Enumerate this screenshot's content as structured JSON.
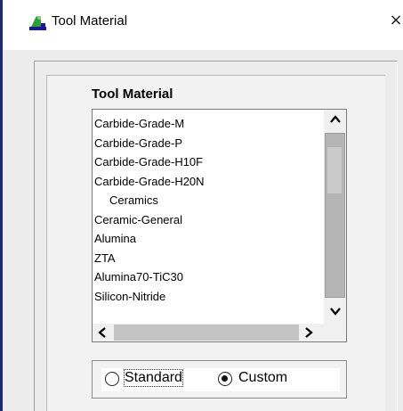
{
  "window": {
    "title": "Tool Material",
    "close_glyph": "×",
    "icon": "tool-material-app-icon"
  },
  "material_list": {
    "label": "Tool Material",
    "items": [
      {
        "label": "Carbide-Grade-M",
        "indented": false
      },
      {
        "label": "Carbide-Grade-P",
        "indented": false
      },
      {
        "label": "Carbide-Grade-H10F",
        "indented": false
      },
      {
        "label": "Carbide-Grade-H20N",
        "indented": false
      },
      {
        "label": "Ceramics",
        "indented": true
      },
      {
        "label": "Ceramic-General",
        "indented": false
      },
      {
        "label": "Alumina",
        "indented": false
      },
      {
        "label": "ZTA",
        "indented": false
      },
      {
        "label": "Alumina70-TiC30",
        "indented": false
      },
      {
        "label": "Silicon-Nitride",
        "indented": false
      }
    ],
    "scroll_up_glyph": "^",
    "scroll_down_glyph": "v",
    "scroll_left_glyph": "<",
    "scroll_right_glyph": ">"
  },
  "material_type": {
    "options": [
      {
        "label": "Standard",
        "checked": false
      },
      {
        "label": "Custom",
        "checked": true
      }
    ]
  }
}
